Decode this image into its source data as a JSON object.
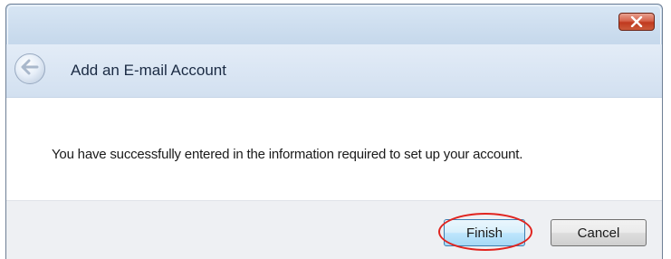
{
  "window": {
    "title": "Add an E-mail Account"
  },
  "titlebar": {
    "close_icon": "close-icon"
  },
  "header": {
    "back_icon": "back-arrow-icon"
  },
  "content": {
    "message": "You have successfully entered in the information required to set up your account."
  },
  "footer": {
    "finish_label": "Finish",
    "cancel_label": "Cancel",
    "highlight_color": "#e0241f"
  },
  "colors": {
    "accent": "#3c7fb1",
    "close_button": "#c0391e"
  }
}
